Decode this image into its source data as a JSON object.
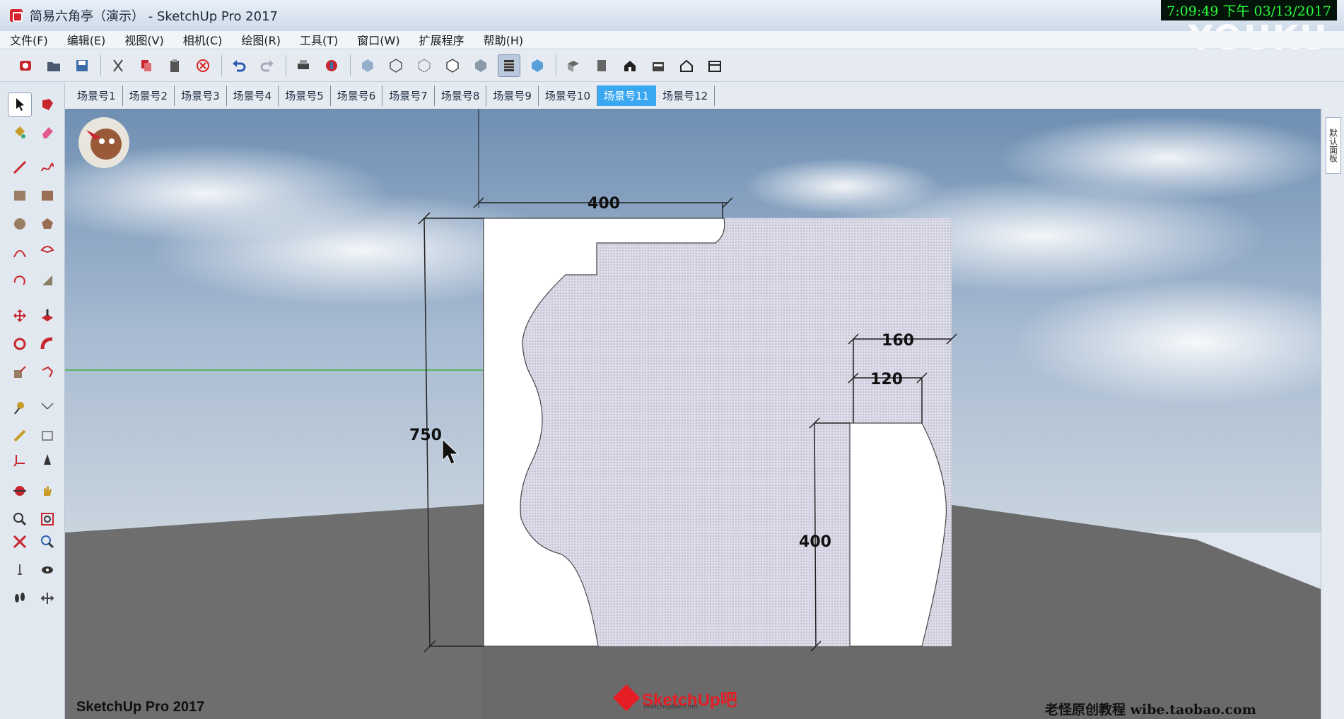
{
  "window": {
    "title": "简易六角亭（演示） - SketchUp Pro 2017",
    "clock": "7:09:49 下午 03/13/2017",
    "watermark": "YOUKU"
  },
  "menu": [
    "文件(F)",
    "编辑(E)",
    "视图(V)",
    "相机(C)",
    "绘图(R)",
    "工具(T)",
    "窗口(W)",
    "扩展程序",
    "帮助(H)"
  ],
  "toolbar": {
    "icons": [
      "get-models-icon",
      "open-icon",
      "save-icon",
      "cut-icon",
      "copy-icon",
      "paste-icon",
      "erase-icon",
      "undo-icon",
      "redo-icon",
      "print-icon",
      "model-info-icon",
      "xray-icon",
      "back-edges-icon",
      "wireframe-icon",
      "hidden-line-icon",
      "shaded-icon",
      "shaded-textures-icon",
      "monochrome-icon",
      "iso-view-icon",
      "top-view-icon",
      "front-view-icon",
      "right-view-icon",
      "back-view-icon",
      "left-view-icon"
    ],
    "active_icon": "shaded-textures-icon"
  },
  "palette": {
    "tools": [
      "select",
      "make-component",
      "paint-bucket",
      "eraser",
      "line",
      "freehand",
      "rectangle",
      "rotated-rectangle",
      "circle",
      "polygon",
      "arc",
      "pie",
      "three-point-arc",
      "two-point-arc",
      "move",
      "push-pull",
      "rotate",
      "follow-me",
      "scale",
      "offset",
      "tape-measure",
      "dimension",
      "protractor",
      "text",
      "axes",
      "3d-text",
      "orbit",
      "pan",
      "zoom",
      "zoom-window",
      "zoom-extents",
      "previous-view",
      "position-camera",
      "look-around",
      "walk",
      "section-plane"
    ],
    "active_tool": "select"
  },
  "scene_tabs": {
    "tabs": [
      "场景号1",
      "场景号2",
      "场景号3",
      "场景号4",
      "场景号5",
      "场景号6",
      "场景号7",
      "场景号8",
      "场景号9",
      "场景号10",
      "场景号11",
      "场景号12"
    ],
    "active": "场景号11"
  },
  "viewport": {
    "dimensions": {
      "top_width": "400",
      "height": "750",
      "inner_offset": "160",
      "inner_width": "120",
      "inner_height": "400"
    },
    "colors": {
      "sky": "#8da9c7",
      "ground": "#6e6e6e",
      "profile_fill": "#d9d8e6",
      "axis_green": "#3db33d"
    }
  },
  "right_panel": {
    "tab_label": "默认面板"
  },
  "footer": {
    "app_label": "SketchUp Pro 2017",
    "logo_text": "SketchUp吧",
    "logo_sub": "sketchupbar.com",
    "credit": "老怪原创教程  wibe.taobao.com"
  }
}
